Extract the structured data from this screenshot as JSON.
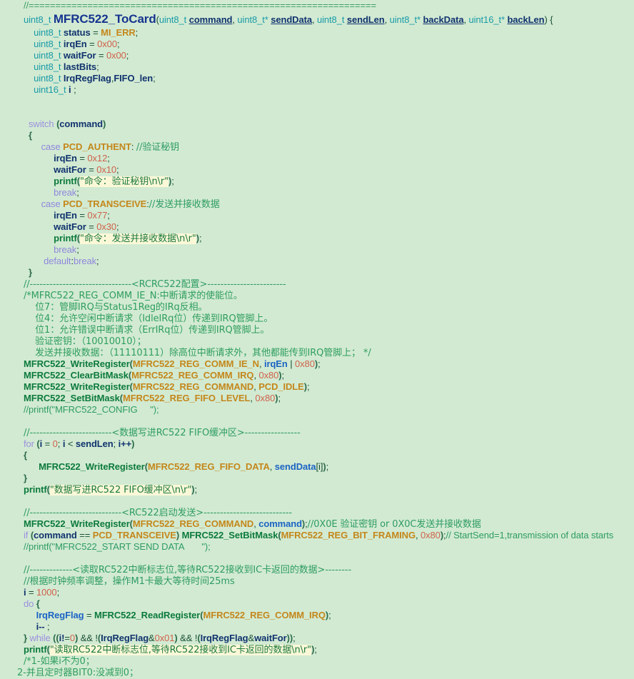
{
  "document": {
    "type": "source-code-screenshot",
    "language": "C",
    "function_name": "MFRC522_ToCard",
    "background_color": "#d2ead2",
    "colors": {
      "comment": "#2e9c62",
      "type": "#1a9ba8",
      "variable": "#10336e",
      "number": "#d0614a",
      "keyword": "#9b8fe0",
      "function": "#0c7a3c",
      "macro": "#c4871b",
      "string_bg": "#fbf8d8",
      "function_title": "#16348f"
    }
  },
  "lines": {
    "l1_sep": "//=================================================================",
    "l2": {
      "ret": "uint8_t ",
      "name": "MFRC522_ToCard",
      "p_open": "(",
      "a1t": "uint8_t ",
      "a1n": "command",
      "c1": ", ",
      "a2t": "uint8_t* ",
      "a2n": "sendData",
      "c2": ", ",
      "a3t": "uint8_t ",
      "a3n": "sendLen",
      "c3": ", ",
      "a4t": "uint8_t* ",
      "a4n": "backData",
      "c4": ", ",
      "a5t": "uint16_t* ",
      "a5n": "backLen",
      "p_close": ") {"
    },
    "l3": {
      "t": "uint8_t ",
      "v": "status",
      "eq": " = ",
      "m": "MI_ERR",
      "s": ";"
    },
    "l4": {
      "t": "uint8_t ",
      "v": "irqEn",
      "eq": " = ",
      "n": "0x00",
      "s": ";"
    },
    "l5": {
      "t": "uint8_t ",
      "v": "waitFor",
      "eq": " = ",
      "n": "0x00",
      "s": ";"
    },
    "l6": {
      "t": "uint8_t ",
      "v": "lastBits",
      "s": ";"
    },
    "l7": {
      "t": "uint8_t ",
      "v": "IrqRegFlag",
      "c": ",",
      "v2": "FIFO_len",
      "s": ";"
    },
    "l8": {
      "t": "uint16_t ",
      "v": "i",
      "s": " ;"
    },
    "l10": {
      "kw": "switch ",
      "p1": "(",
      "v": "command",
      "p2": ")"
    },
    "l11": "{",
    "l12": {
      "kw": "case ",
      "m": "PCD_AUTHENT",
      "colon": ": ",
      "cmt": "//验证秘钥"
    },
    "l13": {
      "v": "irqEn",
      "eq": " = ",
      "n": "0x12",
      "s": ";"
    },
    "l14": {
      "v": "waitFor",
      "eq": " = ",
      "n": "0x10",
      "s": ";"
    },
    "l15": {
      "fn": "printf",
      "p1": "(",
      "str": "\"命令：验证秘钥\\n\\r\"",
      "p2": ")",
      "s": ";"
    },
    "l16": {
      "kw": "break",
      "s": ";"
    },
    "l17": {
      "kw": "case ",
      "m": "PCD_TRANSCEIVE",
      "colon": ":",
      "cmt": "//发送并接收数据"
    },
    "l18": {
      "v": "irqEn",
      "eq": " = ",
      "n": "0x77",
      "s": ";"
    },
    "l19": {
      "v": "waitFor",
      "eq": " = ",
      "n": "0x30",
      "s": ";"
    },
    "l20": {
      "fn": "printf",
      "p1": "(",
      "str": "\"命令：发送并接收数据\\n\\r\"",
      "p2": ")",
      "s": ";"
    },
    "l21": {
      "kw": "break",
      "s": ";"
    },
    "l22": {
      "kw": "default",
      "colon": ":",
      "kw2": "break",
      "s": ";"
    },
    "l23": "}",
    "l24_cmt": "//-------------------------------<RCRC522配置>------------------------",
    "l25_cmt": "/*MFRC522_REG_COMM_IE_N:中断请求的使能位。",
    "l26_cmt": "    位7：管脚IRQ与Status1Reg的IRq反相。",
    "l27_cmt": "    位4：允许空闲中断请求（IdleIRq位）传递到IRQ管脚上。",
    "l28_cmt": "    位1：允许错误中断请求（ErrIRq位）传递到IRQ管脚上。",
    "l29_cmt": "    验证密钥：（10010010）；",
    "l30_cmt": "    发送并接收数据：（11110111）除高位中断请求外，其他都能传到IRQ管脚上； */",
    "l31": {
      "fn": "MFRC522_WriteRegister",
      "p1": "(",
      "m": "MFRC522_REG_COMM_IE_N",
      "c": ", ",
      "v": "irqEn",
      "op": " | ",
      "n": "0x80",
      "p2": ")",
      "s": ";"
    },
    "l32": {
      "fn": "MFRC522_ClearBitMask",
      "p1": "(",
      "m": "MFRC522_REG_COMM_IRQ",
      "c": ", ",
      "n": "0x80",
      "p2": ")",
      "s": ";"
    },
    "l33": {
      "fn": "MFRC522_WriteRegister",
      "p1": "(",
      "m": "MFRC522_REG_COMMAND",
      "c": ", ",
      "m2": "PCD_IDLE",
      "p2": ")",
      "s": ";"
    },
    "l34": {
      "fn": "MFRC522_SetBitMask",
      "p1": "(",
      "m": "MFRC522_REG_FIFO_LEVEL",
      "c": ", ",
      "n": "0x80",
      "p2": ")",
      "s": ";"
    },
    "l35_cmt": "//printf(\"MFRC522_CONFIG     \");",
    "l37_cmt": "//-------------------------<数据写进RC522 FIFO缓冲区>-----------------",
    "l38": {
      "kw": "for ",
      "p1": "(",
      "v": "i",
      "eq": " = ",
      "n": "0",
      "s1": "; ",
      "v2": "i",
      "op": " < ",
      "v3": "sendLen",
      "s2": "; ",
      "v4": "i++",
      "p2": ")"
    },
    "l39": "{",
    "l40": {
      "fn": "MFRC522_WriteRegister",
      "p1": "(",
      "m": "MFRC522_REG_FIFO_DATA",
      "c": ", ",
      "v": "sendData",
      "br": "[i]",
      "p2": ")",
      "s": ";"
    },
    "l41": "}",
    "l42": {
      "fn": "printf",
      "p1": "(",
      "str": "\"数据写进RC522 FIFO缓冲区\\n\\r\"",
      "p2": ")",
      "s": ";"
    },
    "l44_cmt": "//----------------------------<RC522启动发送>---------------------------",
    "l45": {
      "fn": "MFRC522_WriteRegister",
      "p1": "(",
      "m": "MFRC522_REG_COMMAND",
      "c": ", ",
      "v": "command",
      "p2": ")",
      "s": ";",
      "cmt": "//0X0E 验证密钥 or 0X0C发送并接收数据"
    },
    "l46": {
      "kw": "if ",
      "p1": "(",
      "v": "command",
      "op": " == ",
      "m": "PCD_TRANSCEIVE",
      "p2": ") ",
      "fn": "MFRC522_SetBitMask",
      "p3": "(",
      "m2": "MFRC522_REG_BIT_FRAMING",
      "c": ", ",
      "n": "0x80",
      "p4": ")",
      "s": ";",
      "cmt": "// StartSend=1,transmission of data starts"
    },
    "l47_cmt": "//printf(\"MFRC522_START SEND DATA       \");",
    "l49_cmt": "//-------------<读取RC522中断标志位,等待RC522接收到IC卡返回的数据>--------",
    "l50_cmt": "//根据时钟频率调整，操作M1卡最大等待时间25ms",
    "l51": {
      "v": "i",
      "eq": " = ",
      "n": "1000",
      "s": ";"
    },
    "l52": {
      "kw": "do",
      "br": " {"
    },
    "l53": {
      "v": "IrqRegFlag",
      "eq": " = ",
      "fn": "MFRC522_ReadRegister",
      "p1": "(",
      "m": "MFRC522_REG_COMM_IRQ",
      "p2": ")",
      "s": ";"
    },
    "l54": {
      "v": "i--",
      "s": " ;"
    },
    "l55": {
      "br": "} ",
      "kw": "while ",
      "p1": "(",
      "p2": "(",
      "v": "i!",
      "eq": "=",
      "n": "0",
      "p3": ")",
      "op": " && ",
      "neg": "!",
      "p4": "(",
      "v2": "IrqRegFlag",
      "amp": "&",
      "n2": "0x01",
      "p5": ")",
      "op2": " && ",
      "neg2": "!",
      "p6": "(",
      "v3": "IrqRegFlag",
      "amp2": "&",
      "v4": "waitFor",
      "p7": ")",
      "p8": ")",
      "s": ";"
    },
    "l56": {
      "fn": "printf",
      "p1": "(",
      "str": "\"读取RC522中断标志位,等待RC522接收到IC卡返回的数据\\n\\r\"",
      "p2": ")",
      "s": ";"
    },
    "l57_cmt": "/*1-如果i不为0；",
    "l58_cmt": "2-并且定时器BIT0:没减到0；"
  }
}
